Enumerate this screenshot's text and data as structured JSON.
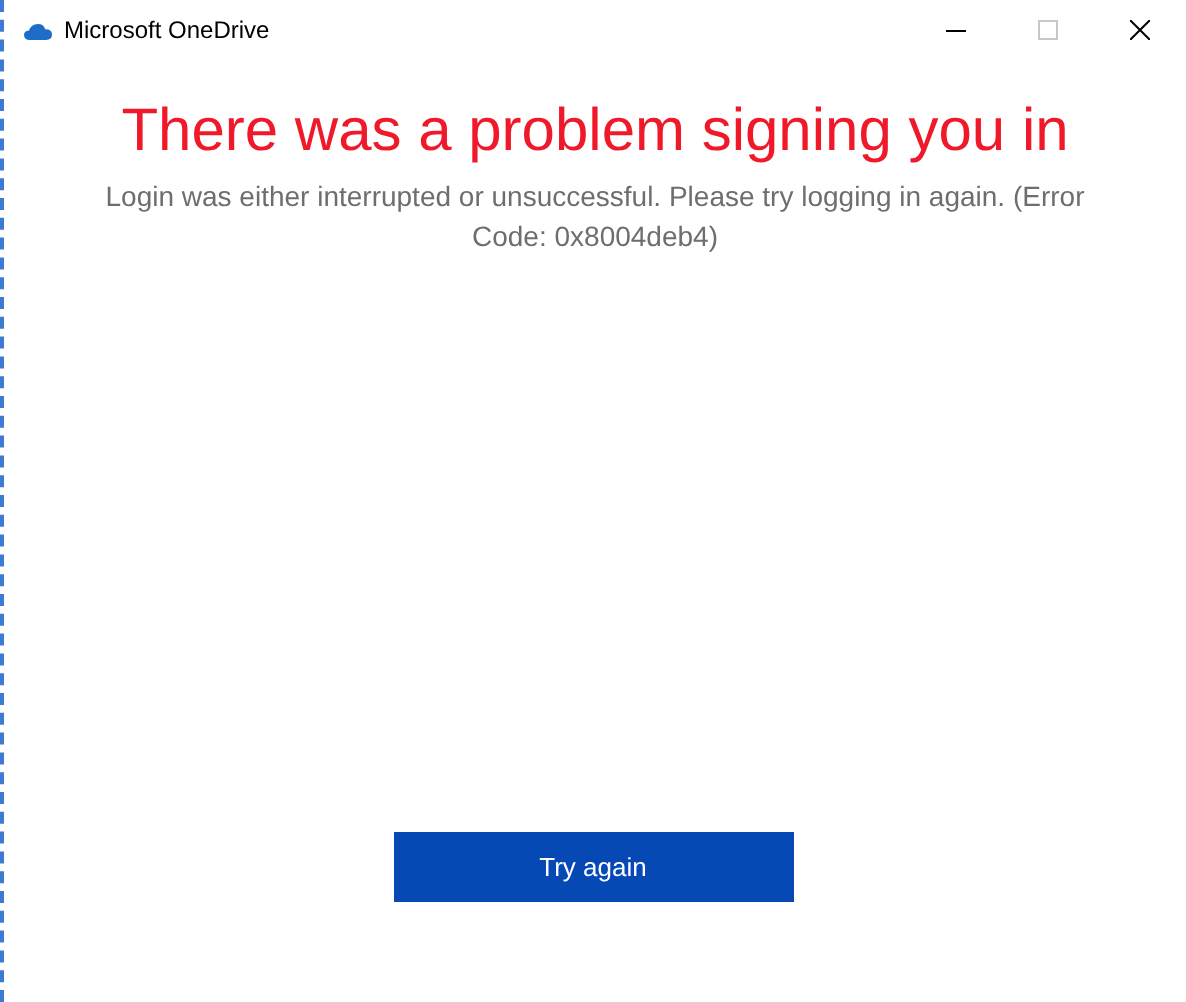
{
  "window": {
    "title": "Microsoft OneDrive"
  },
  "heading": "There was a problem signing you in",
  "message": "Login was either interrupted or unsuccessful. Please try logging in again. (Error Code: 0x8004deb4)",
  "button": {
    "label": "Try again"
  }
}
